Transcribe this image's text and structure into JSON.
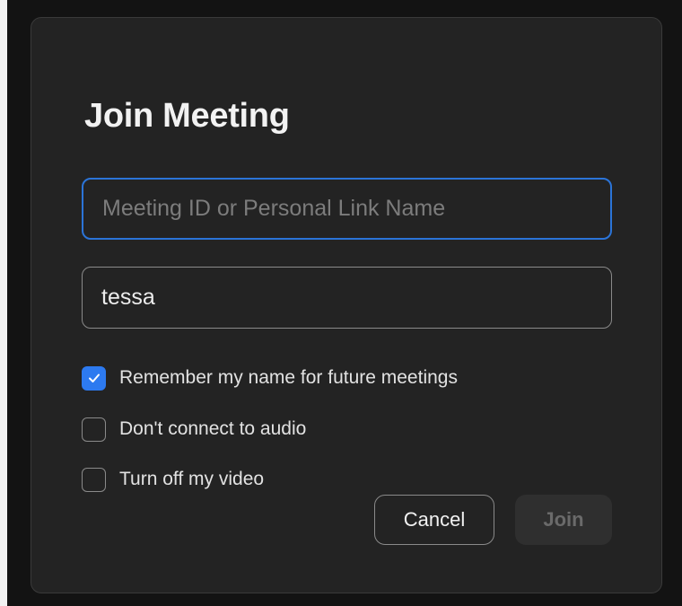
{
  "dialog": {
    "title": "Join Meeting",
    "meeting_field": {
      "value": "",
      "placeholder": "Meeting ID or Personal Link Name"
    },
    "name_field": {
      "value": "tessa"
    },
    "options": [
      {
        "label": "Remember my name for future meetings",
        "checked": true
      },
      {
        "label": "Don't connect to audio",
        "checked": false
      },
      {
        "label": "Turn off my video",
        "checked": false
      }
    ],
    "buttons": {
      "cancel_label": "Cancel",
      "join_label": "Join"
    }
  },
  "colors": {
    "accent": "#2d7af0",
    "dialog_background": "#232323",
    "focus_border": "#2b74d8"
  },
  "icons": {
    "checkmark": "checkmark-icon"
  }
}
